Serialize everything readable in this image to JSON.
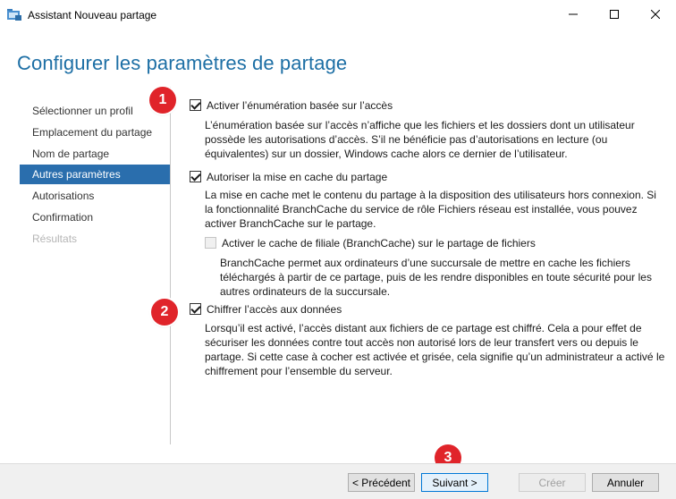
{
  "window": {
    "title": "Assistant Nouveau partage",
    "icon": "share-folder-icon"
  },
  "page": {
    "title": "Configurer les paramètres de partage"
  },
  "nav": {
    "items": [
      {
        "label": "Sélectionner un profil",
        "state": "normal"
      },
      {
        "label": "Emplacement du partage",
        "state": "normal"
      },
      {
        "label": "Nom de partage",
        "state": "normal"
      },
      {
        "label": "Autres paramètres",
        "state": "active"
      },
      {
        "label": "Autorisations",
        "state": "normal"
      },
      {
        "label": "Confirmation",
        "state": "normal"
      },
      {
        "label": "Résultats",
        "state": "disabled"
      }
    ]
  },
  "options": {
    "abe": {
      "label": "Activer l’énumération basée sur l’accès",
      "checked": true,
      "desc_lines": [
        "L’énumération basée sur l’accès n’affiche que les fichiers et les dossiers dont un utilisateur",
        "possède les autorisations d’accès. S’il ne bénéficie pas d’autorisations en lecture (ou",
        "équivalentes) sur un dossier, Windows cache alors ce dernier de l’utilisateur."
      ]
    },
    "cache": {
      "label": "Autoriser la mise en cache du partage",
      "checked": true,
      "desc_lines": [
        "La mise en cache met le contenu du partage à la disposition des utilisateurs hors connexion. Si",
        "la fonctionnalité BranchCache du service de rôle Fichiers réseau est installée, vous pouvez",
        "activer BranchCache sur le partage."
      ]
    },
    "branchcache": {
      "label": "Activer le cache de filiale (BranchCache) sur le partage de fichiers",
      "checked": false,
      "disabled": true,
      "desc_lines": [
        "BranchCache permet aux ordinateurs d’une succursale de mettre en cache les fichiers",
        "téléchargés à partir de ce partage, puis de les rendre disponibles en toute sécurité pour les",
        "autres ordinateurs de la succursale."
      ]
    },
    "encrypt": {
      "label": "Chiffrer l’accès aux données",
      "checked": true,
      "desc_lines": [
        "Lorsqu’il est activé, l’accès distant aux fichiers de ce partage est chiffré. Cela a pour effet de",
        "sécuriser les données contre tout accès non autorisé lors de leur transfert vers ou depuis le",
        "partage. Si cette case à cocher est activée et grisée, cela signifie qu’un administrateur a activé le",
        "chiffrement pour l’ensemble du serveur."
      ]
    }
  },
  "badges": [
    "1",
    "2",
    "3"
  ],
  "buttons": {
    "previous": "< Précédent",
    "next": "Suivant >",
    "create": "Créer",
    "cancel": "Annuler"
  },
  "colors": {
    "title_blue": "#1d6fa5",
    "nav_active": "#2a6ead",
    "badge_red": "#e0242a"
  }
}
